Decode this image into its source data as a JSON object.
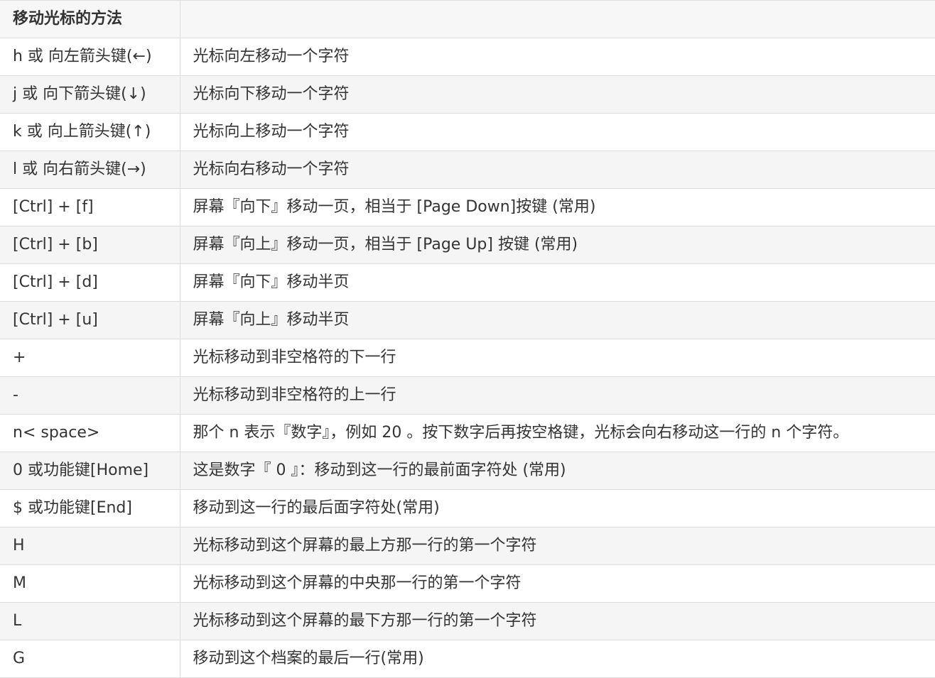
{
  "table": {
    "header": [
      "移动光标的方法",
      ""
    ],
    "rows": [
      {
        "key": "h 或 向左箭头键(←)",
        "desc": "光标向左移动一个字符"
      },
      {
        "key": "j 或 向下箭头键(↓)",
        "desc": "光标向下移动一个字符"
      },
      {
        "key": "k 或 向上箭头键(↑)",
        "desc": "光标向上移动一个字符"
      },
      {
        "key": "l 或 向右箭头键(→)",
        "desc": "光标向右移动一个字符"
      },
      {
        "key": "[Ctrl] + [f]",
        "desc": "屏幕『向下』移动一页，相当于 [Page Down]按键 (常用)"
      },
      {
        "key": "[Ctrl] + [b]",
        "desc": "屏幕『向上』移动一页，相当于 [Page Up] 按键 (常用)"
      },
      {
        "key": "[Ctrl] + [d]",
        "desc": "屏幕『向下』移动半页"
      },
      {
        "key": "[Ctrl] + [u]",
        "desc": "屏幕『向上』移动半页"
      },
      {
        "key": "+",
        "desc": "光标移动到非空格符的下一行"
      },
      {
        "key": "-",
        "desc": "光标移动到非空格符的上一行"
      },
      {
        "key": "n< space>",
        "desc": "那个 n 表示『数字』，例如 20 。按下数字后再按空格键，光标会向右移动这一行的 n 个字符。"
      },
      {
        "key": "0 或功能键[Home]",
        "desc": "这是数字『 0 』：移动到这一行的最前面字符处 (常用)"
      },
      {
        "key": "$ 或功能键[End]",
        "desc": "移动到这一行的最后面字符处(常用)"
      },
      {
        "key": "H",
        "desc": "光标移动到这个屏幕的最上方那一行的第一个字符"
      },
      {
        "key": "M",
        "desc": "光标移动到这个屏幕的中央那一行的第一个字符"
      },
      {
        "key": "L",
        "desc": "光标移动到这个屏幕的最下方那一行的第一个字符"
      },
      {
        "key": "G",
        "desc": "移动到这个档案的最后一行(常用)"
      }
    ]
  }
}
